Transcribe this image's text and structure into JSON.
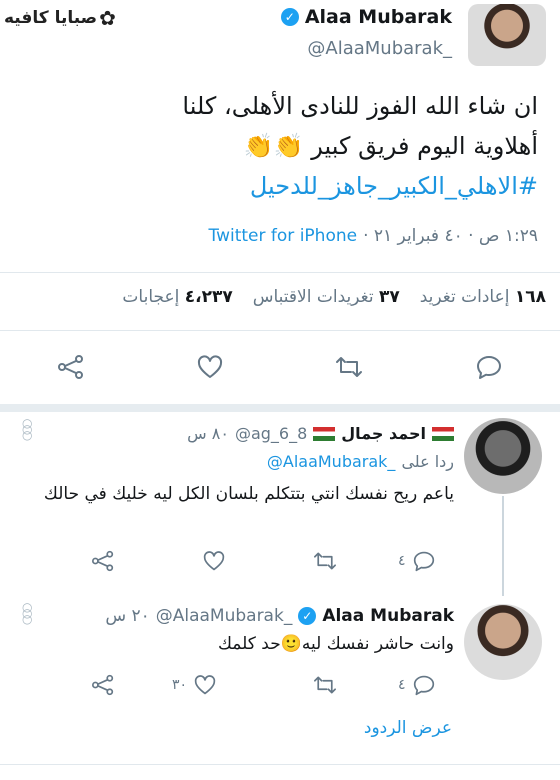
{
  "watermark": "صبايا كافيه",
  "tweet": {
    "author_name": "Alaa Mubarak",
    "author_handle": "@AlaaMubarak_",
    "line1": "ان شاء الله الفوز للنادى الأهلى، كلنا",
    "line2": "أهلاوية  اليوم فريق كبير",
    "emoji": "👏👏",
    "hashtag": "#الاهلي_الكبير_جاهز_للدحيل",
    "timestamp": "١:٢٩ ص · ٤٠ فبراير ٢١ ·",
    "source": "Twitter for iPhone",
    "stats": {
      "retweets_count": "١٦٨",
      "retweets_label": "إعادات تغريد",
      "quotes_count": "٣٧",
      "quotes_label": "تغريدات الاقتباس",
      "likes_count": "٤،٢٣٧",
      "likes_label": "إعجابات"
    }
  },
  "reply1": {
    "author_name": "احمد جمال",
    "author_handle": "@ag_6_8",
    "time": "٨٠ س",
    "replying_label": "ردا على",
    "replying_handle": "@AlaaMubarak_",
    "text": "ياعم ريح نفسك انتي بتتكلم بلسان الكل ليه خليك في حالك",
    "reply_count": "٤"
  },
  "reply2": {
    "author_name": "Alaa Mubarak",
    "author_handle": "@AlaaMubarak_",
    "time": "٢٠ س",
    "text": "وانت حاشر نفسك ليه🙂حد كلمك",
    "reply_count": "٤",
    "like_count": "٣٠"
  },
  "show_replies": "عرض الردود",
  "colors": {
    "accent": "#1b95e0",
    "muted": "#657786",
    "divider": "#e1e8ed"
  }
}
